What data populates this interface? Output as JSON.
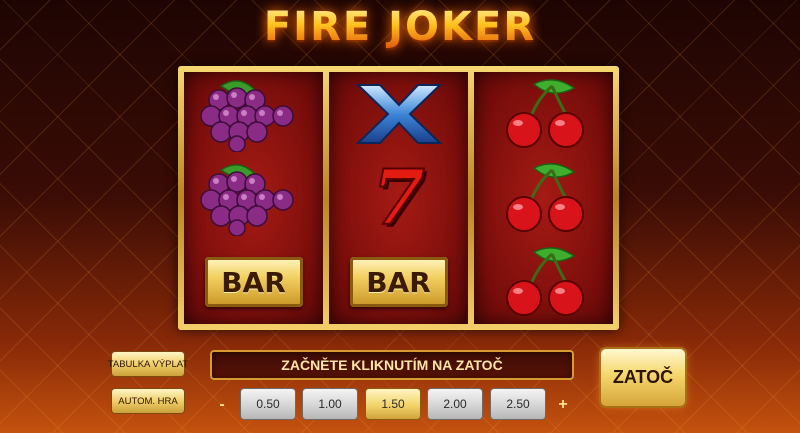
{
  "game": {
    "title": "FIRE JOKER"
  },
  "reels": [
    [
      "grapes-icon",
      "grapes-icon",
      "bar"
    ],
    [
      "x-icon",
      "seven-icon",
      "bar"
    ],
    [
      "cherries-icon",
      "cherries-icon",
      "cherries-icon"
    ]
  ],
  "symbols": {
    "bar_label": "BAR",
    "seven_label": "7"
  },
  "controls": {
    "paytable_label": "TABULKA VÝPLAT",
    "autoplay_label": "AUTOM. HRA",
    "message": "ZAČNĚTE KLIKNUTÍM NA ZATOČ",
    "minus_label": "-",
    "plus_label": "+",
    "bets": [
      "0.50",
      "1.00",
      "1.50",
      "2.00",
      "2.50"
    ],
    "selected_bet": "1.50",
    "spin_label": "ZATOČ"
  },
  "colors": {
    "gold": "#f0cf6a",
    "reel_red": "#a61a14",
    "title_orange": "#ffc21f"
  }
}
